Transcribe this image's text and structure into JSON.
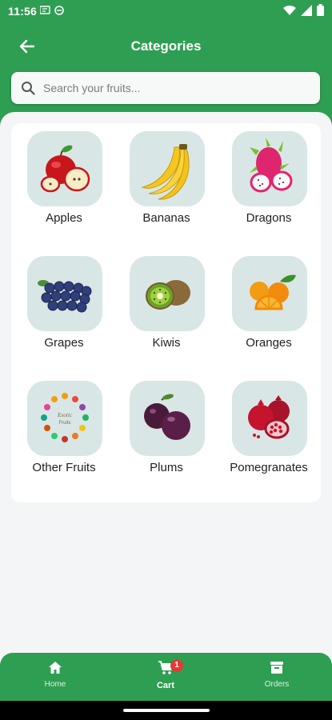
{
  "status_bar": {
    "time": "11:56"
  },
  "header": {
    "title": "Categories"
  },
  "search": {
    "placeholder": "Search your fruits..."
  },
  "categories": [
    {
      "label": "Apples"
    },
    {
      "label": "Bananas"
    },
    {
      "label": "Dragons"
    },
    {
      "label": "Grapes"
    },
    {
      "label": "Kiwis"
    },
    {
      "label": "Oranges"
    },
    {
      "label": "Other Fruits"
    },
    {
      "label": "Plums"
    },
    {
      "label": "Pomegranates"
    }
  ],
  "nav": {
    "home_label": "Home",
    "cart_label": "Cart",
    "cart_count": "1",
    "orders_label": "Orders"
  },
  "colors": {
    "primary": "#2e9e52",
    "tile": "#d9e6e6",
    "badge": "#e53935"
  }
}
